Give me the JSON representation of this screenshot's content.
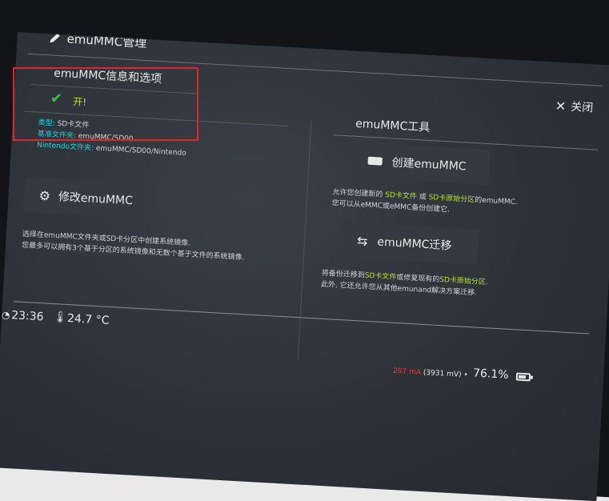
{
  "header": {
    "title": "emuMMC管理",
    "close_label": "关闭"
  },
  "info": {
    "heading": "emuMMC信息和选项",
    "status": "开!",
    "type_label": "类型:",
    "type_value": "SD卡文件",
    "base_folder_label": "基准文件夹:",
    "base_folder_value": "emuMMC/SD00",
    "nintendo_folder_label": "Nintendo文件夹:",
    "nintendo_folder_value": "emuMMC/SD00/Nintendo"
  },
  "modify": {
    "button_label": "修改emuMMC",
    "desc_line1": "选择在emuMMC文件夹或SD卡分区中创建系统镜像.",
    "desc_line2": "您最多可以拥有3个基于分区的系统镜像和无数个基于文件的系统镜像."
  },
  "tools": {
    "heading": "emuMMC工具",
    "create_button": "创建emuMMC",
    "create_desc_1": "允许您创建新的",
    "create_desc_sd_file": "SD卡文件",
    "create_desc_or": "或",
    "create_desc_partition": "SD卡原始分区",
    "create_desc_end": "的emuMMC.",
    "create_desc_line2": "您可以从eMMC或eMMC备份创建它.",
    "migrate_button": "emuMMC迁移",
    "migrate_desc_1": "将备份迁移到",
    "migrate_desc_sd_file": "SD卡文件",
    "migrate_desc_mid": "或修复现有的",
    "migrate_desc_partition": "SD卡原始分区",
    "migrate_desc_end": ".",
    "migrate_desc_line2": "此外, 它还允许您从其他emunand解决方案迁移."
  },
  "status_bar": {
    "time": "23:36",
    "temperature": "24.7 °C",
    "current": "287 mA",
    "voltage": "(3931 mV)",
    "battery_percent": "76.1%",
    "battery_level": 0.761
  },
  "colors": {
    "highlight": "#e0262b",
    "accent_cyan": "#1ed0e0",
    "accent_green": "#b6e23a"
  }
}
